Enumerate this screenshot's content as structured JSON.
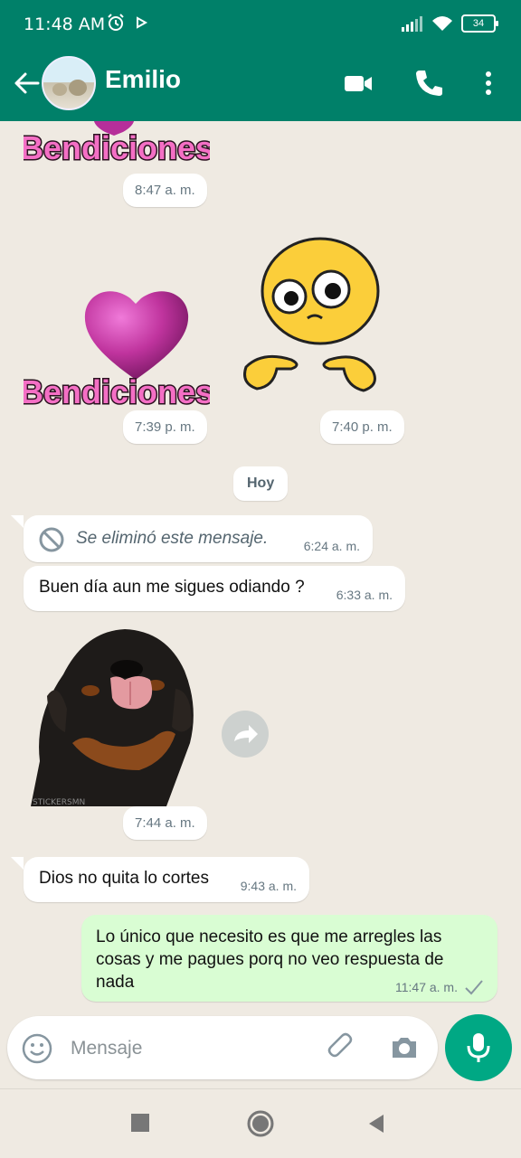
{
  "status_bar": {
    "time": "11:48 AM",
    "battery": "34"
  },
  "header": {
    "contact_name": "Emilio"
  },
  "messages": [
    {
      "type": "sticker",
      "sticker_text": "Bendiciones",
      "time": "8:47 a. m."
    },
    {
      "type": "sticker",
      "sticker_text": "Bendiciones",
      "time": "7:39 p. m."
    },
    {
      "type": "sticker",
      "sticker_text": "",
      "time": "7:40 p. m."
    },
    {
      "type": "date",
      "label": "Hoy"
    },
    {
      "type": "deleted",
      "text": "Se eliminó este mensaje.",
      "time": "6:24 a. m."
    },
    {
      "type": "text",
      "text": "Buen día aun me sigues odiando ?",
      "time": "6:33 a. m."
    },
    {
      "type": "sticker",
      "sticker_text": "STICKERSMN",
      "time": "7:44 a. m."
    },
    {
      "type": "text",
      "text": "Dios no quita lo cortes",
      "time": "9:43 a. m."
    },
    {
      "type": "outgoing",
      "text": "Lo único que necesito es que me arregles las cosas y me pagues porq no veo respuesta de nada",
      "time": "11:47 a. m."
    }
  ],
  "composer": {
    "placeholder": "Mensaje"
  },
  "colors": {
    "brand": "#008069",
    "outgoing_bubble": "#d9fdd3",
    "mic_button": "#00a884",
    "chat_background": "#efeae2"
  }
}
